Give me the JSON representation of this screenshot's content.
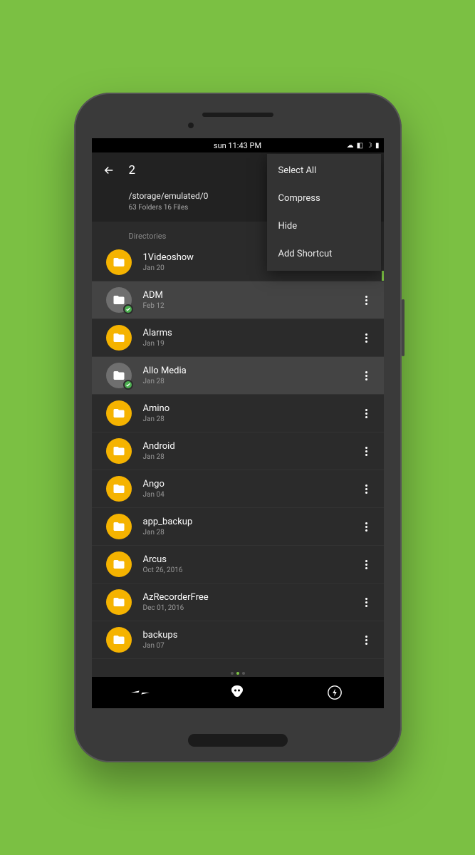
{
  "statusbar": {
    "time": "sun 11:43 PM"
  },
  "header": {
    "selection_count": "2",
    "path": "/storage/emulated/0",
    "summary": "63 Folders 16 Files"
  },
  "section_label": "Directories",
  "menu": {
    "select_all": "Select All",
    "compress": "Compress",
    "hide": "Hide",
    "add_shortcut": "Add Shortcut"
  },
  "items": [
    {
      "name": "1Videoshow",
      "date": "Jan 20",
      "selected": false
    },
    {
      "name": "ADM",
      "date": "Feb 12",
      "selected": true
    },
    {
      "name": "Alarms",
      "date": "Jan 19",
      "selected": false
    },
    {
      "name": "Allo Media",
      "date": "Jan 28",
      "selected": true
    },
    {
      "name": "Amino",
      "date": "Jan 28",
      "selected": false
    },
    {
      "name": "Android",
      "date": "Jan 28",
      "selected": false
    },
    {
      "name": "Ango",
      "date": "Jan 04",
      "selected": false
    },
    {
      "name": "app_backup",
      "date": "Jan 28",
      "selected": false
    },
    {
      "name": "Arcus",
      "date": "Oct 26, 2016",
      "selected": false
    },
    {
      "name": "AzRecorderFree",
      "date": "Dec 01, 2016",
      "selected": false
    },
    {
      "name": "backups",
      "date": "Jan 07",
      "selected": false
    }
  ]
}
